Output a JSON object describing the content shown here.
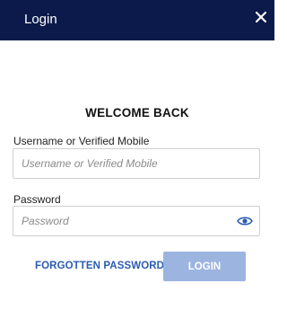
{
  "header": {
    "title": "Login",
    "close_icon": "close-icon",
    "background": "#0b1a4a"
  },
  "form": {
    "heading": "WELCOME BACK",
    "username": {
      "label": "Username or Verified Mobile",
      "placeholder": "Username or Verified Mobile",
      "value": ""
    },
    "password": {
      "label": "Password",
      "placeholder": "Password",
      "value": "",
      "toggle_icon": "eye-icon"
    },
    "forgot_label": "FORGOTTEN PASSWORD",
    "login_label": "LOGIN",
    "accent": "#2b5bb0",
    "login_button_color": "#9cb4e0"
  }
}
